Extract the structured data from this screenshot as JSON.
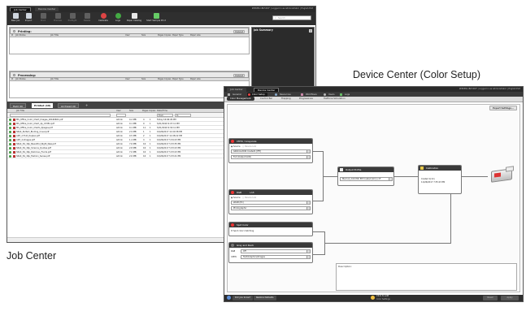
{
  "captions": {
    "device_center": "Device Center (Color Setup)",
    "job_center": "Job Center"
  },
  "job_center": {
    "tabs": [
      "Job Center",
      "Device Center"
    ],
    "account": "SERVER-1BC5DCF | Logged in as Administrator | English  Exit",
    "toolbar": [
      "New Job",
      "Import",
      "Print",
      "Preview",
      "Preflight",
      "Delete",
      "Calibrate",
      "Logs",
      "Paper Catalog",
      "Start Sample Print"
    ],
    "search_placeholder": "Search",
    "printing": {
      "title": "Printing:",
      "cancel": "Cancel",
      "columns": [
        "#",
        "Job Status",
        "Job Title",
        "User",
        "Size",
        "Pages",
        "Copies",
        "Paper Type",
        "Paper size"
      ]
    },
    "job_summary": "Job Summary",
    "processing": {
      "title": "Processing:",
      "cancel": "Cancel",
      "columns": [
        "#",
        "Job Status",
        "Job Title",
        "User",
        "Size",
        "Pages",
        "Copies",
        "Paper Type",
        "Paper size"
      ]
    },
    "list_tabs": [
      "Held (0)",
      "Printed (16)",
      "Archived (0)"
    ],
    "list_columns": [
      "Job Title",
      "User",
      "Size",
      "Pages",
      "Copies",
      "Date/Time",
      "Paper Ty"
    ],
    "filter": {
      "from": "From",
      "to": "To"
    },
    "rows": [
      {
        "title": "MS_Office_Color_Chart_Images_20160601.pdf",
        "user": "Admin",
        "size": "0.2 MB",
        "pages": "4",
        "copies": "1",
        "date": "Today 16:06:29 PM",
        "paper": "Coated-C"
      },
      {
        "title": "MS_Office_Color_Chart_4p_C3381.pdf",
        "user": "Admin",
        "size": "0.1 MB",
        "pages": "9",
        "copies": "1",
        "date": "5/21/2016 9:47:11 PM",
        "paper": "Coated-C"
      },
      {
        "title": "MS_Office_Color_Charts_9pages.pdf",
        "user": "Admin",
        "size": "0.1 MB",
        "pages": "11",
        "copies": "1",
        "date": "5/21/2016 9:34:11 PM",
        "paper": "Coated-C"
      },
      {
        "title": "SRA4_Perfect_Binding_Cover.pdf",
        "user": "Admin",
        "size": "2.9 MB",
        "pages": "1",
        "copies": "1",
        "date": "10/26/2017 11:00:38 PM",
        "paper": "Coated-C"
      },
      {
        "title": "A4H_2-Fold_Duplex.pdf",
        "user": "Admin",
        "size": "0.5 MB",
        "pages": "2",
        "copies": "1",
        "date": "10/26/2017 11:08:22 PM",
        "paper": "Coated-C"
      },
      {
        "title": "A4H_4-Images.pdf",
        "user": "Admin",
        "size": "1.4 MB",
        "pages": "4",
        "copies": "1",
        "date": "10/26/2017 5:34:23 PM",
        "paper": "Coated-C"
      },
      {
        "title": "SRA4_SS_16p_Beautiful_Night_New.pdf",
        "user": "Admin",
        "size": "7.6 MB",
        "pages": "16",
        "copies": "1",
        "date": "10/26/2017 5:33:35 PM",
        "paper": "Coated-C"
      },
      {
        "title": "SRA4_SS_16p_Science_Quotes.pdf",
        "user": "Admin",
        "size": "2.8 MB",
        "pages": "16",
        "copies": "1",
        "date": "10/26/2017 5:33:23 PM",
        "paper": "Coated-C"
      },
      {
        "title": "SRA4_SS_16p_Delicious_Foods.pdf",
        "user": "Admin",
        "size": "7.0 MB",
        "pages": "16",
        "copies": "1",
        "date": "10/26/2017 5:33:23 PM",
        "paper": "Coated-C"
      },
      {
        "title": "SRA4_SS_16p_Fashion_Sense.pdf",
        "user": "Admin",
        "size": "2.6 MB",
        "pages": "16",
        "copies": "1",
        "date": "10/26/2017 5:33:41 PM",
        "paper": "Coated-C"
      }
    ]
  },
  "device_center": {
    "tabs": [
      "Job Center",
      "Device Center"
    ],
    "account": "SERVER-1BC5DCF | Logged in as Administrator | English  Exit",
    "nav": [
      "General",
      "Color Setup",
      "Resources",
      "Workflows",
      "Users",
      "Logs"
    ],
    "subtabs": [
      "Color Management",
      "Control Bar",
      "Trapping",
      "Progressives",
      "Halftone Simulation"
    ],
    "export_button": "Export Settings...",
    "cmyk": {
      "title": "CMYK / Grayscale",
      "source_label": "Source",
      "device_link": "Device Link",
      "profile": "GRACoL2006 Coated1 [EFI]",
      "intent": "Full (Output GCR)"
    },
    "rgb": {
      "title": "RGB",
      "lab": "LAB",
      "source_label": "Source",
      "device_link": "Device Link",
      "profile": "sRGB (PC)",
      "intent": "Photographic"
    },
    "spot": {
      "title": "Spot Color",
      "option": "Spot color matching"
    },
    "gray": {
      "title": "Gray and black",
      "rgb_label": "RGB",
      "rgb_value": "Off",
      "cmyk_label": "CMYK",
      "cmyk_value": "Text/Graphics/Images"
    },
    "output": {
      "title": "Output Profile",
      "value": "Mercury 100 IMC EM Coated [LD] v.1F"
    },
    "calibration": {
      "title": "Calibration",
      "line1": "Coated 1(1C)",
      "line2": "11/26/2017 7:35:23 PM"
    },
    "description_label": "Description:",
    "footer": {
      "did_you_know": "Did you know?",
      "restore": "Restore Defaults",
      "center_text": "Click to edit",
      "center_sub": "Color Settings",
      "reset": "Reset",
      "apply": "Apply"
    }
  }
}
